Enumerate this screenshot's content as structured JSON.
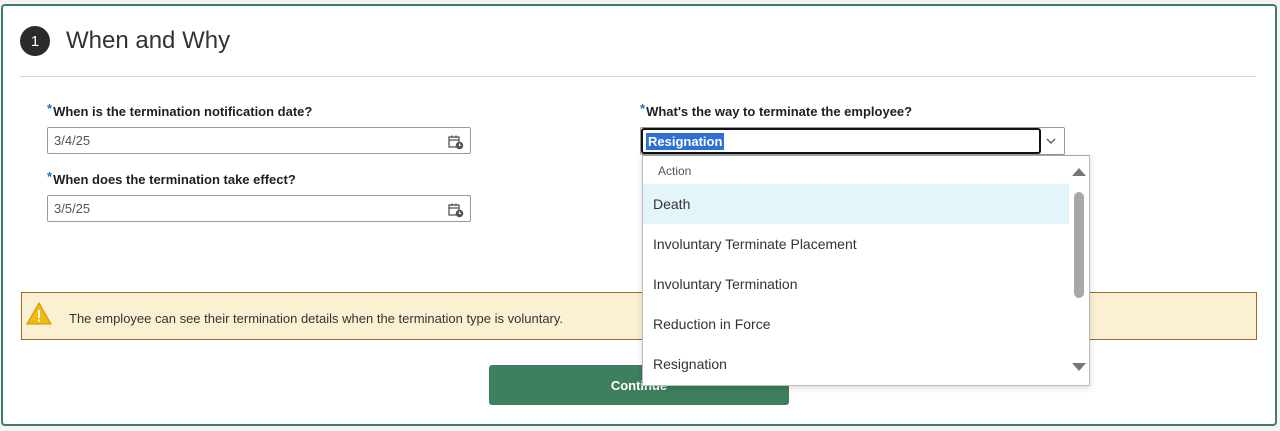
{
  "section": {
    "step_number": "1",
    "title": "When and Why"
  },
  "fields": {
    "notification_date": {
      "label": "When is the termination notification date?",
      "value": "3/4/25",
      "required_mark": "*"
    },
    "effective_date": {
      "label": "When does the termination take effect?",
      "value": "3/5/25",
      "required_mark": "*"
    },
    "termination_way": {
      "label": "What's the way to terminate the employee?",
      "value": "Resignation",
      "required_mark": "*"
    }
  },
  "dropdown": {
    "header": "Action",
    "options": [
      "Death",
      "Involuntary Terminate Placement",
      "Involuntary Termination",
      "Reduction in Force",
      "Resignation"
    ],
    "highlighted": "Death"
  },
  "warning": {
    "text": "The employee can see their termination details when the termination type is voluntary."
  },
  "continue_button": {
    "label": "Continue"
  },
  "colors": {
    "accent": "#3d7f5e",
    "selection": "#2f6fd8",
    "warning_bg": "#fbf0d1",
    "required": "#1e6fb8"
  }
}
